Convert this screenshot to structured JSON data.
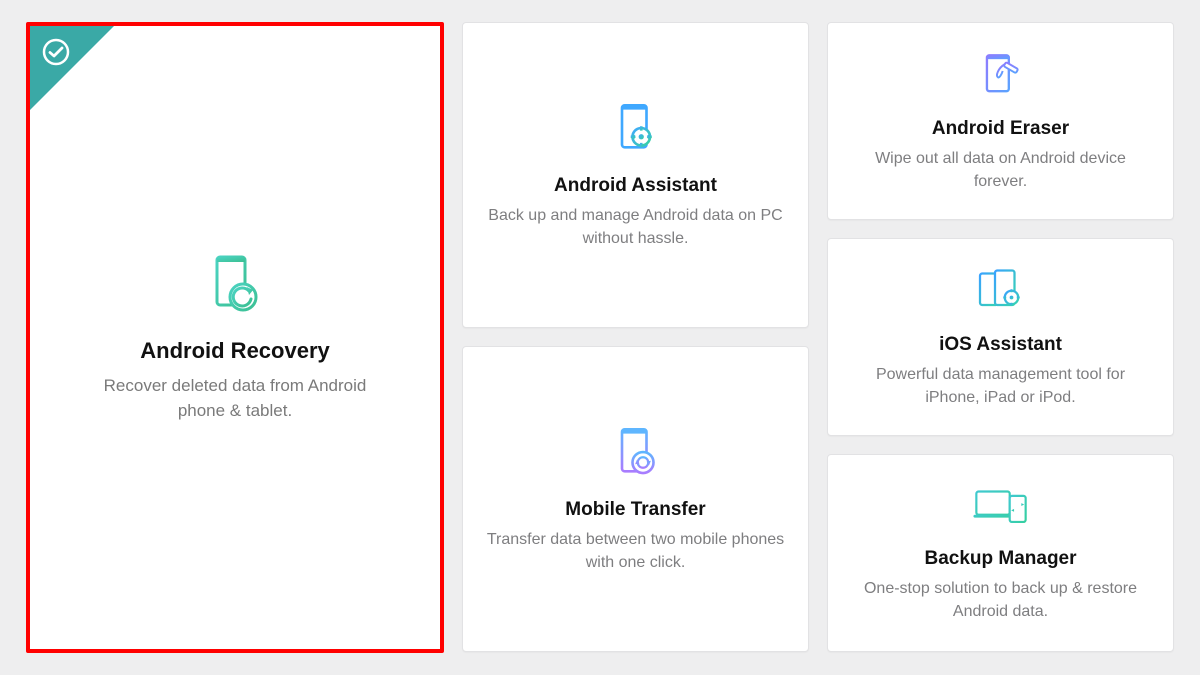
{
  "main_card": {
    "title": "Android Recovery",
    "desc": "Recover deleted data from Android phone & tablet."
  },
  "cards_col_a": [
    {
      "title": "Android Assistant",
      "desc": "Back up and manage Android data on PC without hassle."
    },
    {
      "title": "Mobile Transfer",
      "desc": "Transfer data between two mobile phones with one click."
    }
  ],
  "cards_col_b": [
    {
      "title": "Android Eraser",
      "desc": "Wipe out all data on Android device forever."
    },
    {
      "title": "iOS Assistant",
      "desc": "Powerful data management tool for iPhone, iPad or iPod."
    },
    {
      "title": "Backup Manager",
      "desc": "One-stop solution to back up & restore Android data."
    }
  ]
}
